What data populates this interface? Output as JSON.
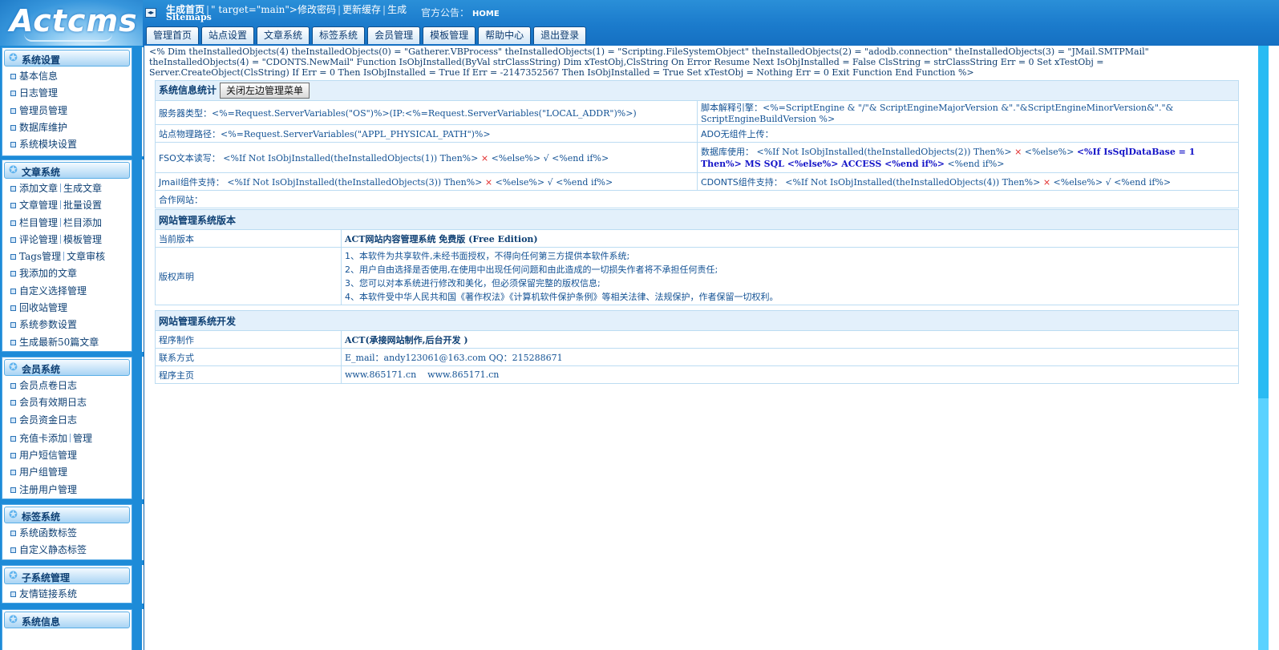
{
  "header": {
    "logo_text": "Actcms",
    "toggle_icon": "◂▸",
    "quicklinks": [
      "生成首页",
      "\" target=\"main\">修改密码",
      "更新缓存",
      "生成"
    ],
    "sitemaps": "Sitemaps",
    "notice_label": "官方公告：",
    "notice_value": "HOME",
    "tabs": [
      "管理首页",
      "站点设置",
      "文章系统",
      "标签系统",
      "会员管理",
      "模板管理",
      "帮助中心",
      "退出登录"
    ]
  },
  "sidebar": {
    "system_settings": {
      "title": "系统设置",
      "items": [
        "基本信息",
        "日志管理",
        "管理员管理",
        "数据库维护",
        "系统模块设置"
      ]
    },
    "article_system": {
      "title": "文章系统",
      "pairs": [
        [
          "添加文章",
          "生成文章"
        ],
        [
          "文章管理",
          "批量设置"
        ],
        [
          "栏目管理",
          "栏目添加"
        ],
        [
          "评论管理",
          "模板管理"
        ],
        [
          "Tags管理",
          "文章审核"
        ]
      ],
      "items": [
        "我添加的文章",
        "自定义选择管理",
        "回收站管理",
        "系统参数设置",
        "生成最新50篇文章"
      ]
    },
    "member_system": {
      "title": "会员系统",
      "items": [
        "会员点卷日志",
        "会员有效期日志",
        "会员资金日志"
      ],
      "pair": [
        "充值卡添加",
        "管理"
      ],
      "items2": [
        "用户短信管理",
        "用户组管理",
        "注册用户管理"
      ]
    },
    "tag_system": {
      "title": "标签系统",
      "items": [
        "系统函数标签",
        "自定义静态标签"
      ]
    },
    "subsystem": {
      "title": "子系统管理",
      "items": [
        "友情链接系统"
      ]
    },
    "system_info": {
      "title": "系统信息"
    }
  },
  "main": {
    "asp_dump": "<% Dim theInstalledObjects(4) theInstalledObjects(0) = \"Gatherer.VBProcess\" theInstalledObjects(1) = \"Scripting.FileSystemObject\" theInstalledObjects(2) = \"adodb.connection\" theInstalledObjects(3) = \"JMail.SMTPMail\" theInstalledObjects(4) = \"CDONTS.NewMail\" Function IsObjInstalled(ByVal strClassString) Dim xTestObj,ClsString On Error Resume Next IsObjInstalled = False ClsString = strClassString Err = 0 Set xTestObj = Server.CreateObject(ClsString) If Err = 0 Then IsObjInstalled = True If Err = -2147352567 Then IsObjInstalled = True Set xTestObj = Nothing Err = 0 Exit Function End Function %>",
    "stats": {
      "title": "系统信息统计",
      "close_btn": "关闭左边管理菜单",
      "server_type_label": "服务器类型：",
      "server_type_value": "<%=Request.ServerVariables(\"OS\")%>(IP:<%=Request.ServerVariables(\"LOCAL_ADDR\")%>)",
      "script_engine_label": "脚本解释引擎：",
      "script_engine_value": "<%=ScriptEngine & \"/\"& ScriptEngineMajorVersion &\".\"&ScriptEngineMinorVersion&\".\"& ScriptEngineBuildVersion %>",
      "physical_path_label": "站点物理路径：",
      "physical_path_value": "<%=Request.ServerVariables(\"APPL_PHYSICAL_PATH\")%>",
      "ado_label": "ADO无组件上传：",
      "fso_label": "FSO文本读写：",
      "fso_value_a": "<%If Not IsObjInstalled(theInstalledObjects(1)) Then%>",
      "fso_value_b": "<%else%>",
      "fso_value_c": "<%end if%>",
      "db_label": "数据库使用：",
      "db_value_a": "<%If Not IsObjInstalled(theInstalledObjects(2)) Then%>",
      "db_value_b": "<%else%>",
      "db_value_c": "<%If IsSqlDataBase = 1 Then%> MS SQL <%else%> ACCESS <%end if%>",
      "db_value_d": "<%end if%>",
      "jmail_label": "Jmail组件支持：",
      "jmail_value_a": "<%If Not IsObjInstalled(theInstalledObjects(3)) Then%>",
      "jmail_value_b": "<%else%>",
      "jmail_value_c": "<%end if%>",
      "cdonts_label": "CDONTS组件支持：",
      "cdonts_value_a": "<%If Not IsObjInstalled(theInstalledObjects(4)) Then%>",
      "cdonts_value_b": "<%else%>",
      "cdonts_value_c": "<%end if%>",
      "partner_label": "合作网站：",
      "cross": "×",
      "check": "√"
    },
    "version": {
      "title": "网站管理系统版本",
      "current_label": "当前版本",
      "current_value": "ACT网站内容管理系统 免费版 (Free Edition)",
      "copyright_label": "版权声明",
      "copyright_lines": [
        "1、本软件为共享软件,未经书面授权，不得向任何第三方提供本软件系统;",
        "2、用户自由选择是否使用,在使用中出现任何问题和由此造成的一切损失作者将不承担任何责任;",
        "3、您可以对本系统进行修改和美化，但必须保留完整的版权信息;",
        "4、本软件受中华人民共和国《著作权法》《计算机软件保护条例》等相关法律、法规保护，作者保留一切权利。"
      ]
    },
    "dev": {
      "title": "网站管理系统开发",
      "author_label": "程序制作",
      "author_value": "ACT(承接网站制作,后台开发 )",
      "contact_label": "联系方式",
      "contact_value": "E_mail：andy123061@163.com QQ：215288671",
      "homepage_label": "程序主页",
      "homepage_values": [
        "www.865171.cn",
        "www.865171.cn"
      ]
    }
  }
}
